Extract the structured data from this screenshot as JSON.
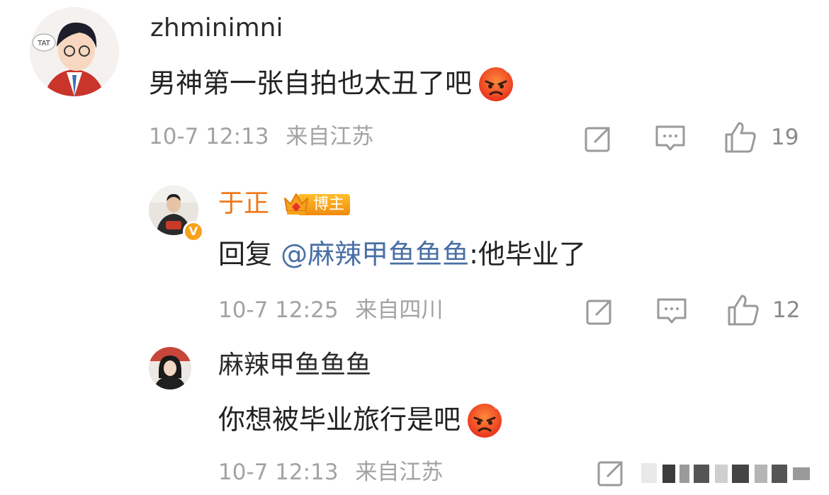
{
  "comments": [
    {
      "username": "zhminimni",
      "text": "男神第一张自拍也太丑了吧",
      "time": "10-7 12:13",
      "location": "来自江苏",
      "likes": "19",
      "avatar_tag": "TAT",
      "emoji": "angry-face-emoji"
    },
    {
      "username": "于正",
      "badge": "博主",
      "verified_mark": "V",
      "reply_prefix": "回复 ",
      "mention": "@麻辣甲鱼鱼鱼",
      "text": ":他毕业了",
      "time": "10-7 12:25",
      "location": "来自四川",
      "likes": "12"
    },
    {
      "username": "麻辣甲鱼鱼鱼",
      "text": "你想被毕业旅行是吧",
      "time": "10-7 12:13",
      "location": "来自江苏",
      "emoji": "angry-face-emoji"
    }
  ],
  "colors": {
    "username": "#2b2b2b",
    "username_highlight": "#f07818",
    "mention": "#4a6fa5",
    "meta": "#a3a3a3",
    "badge": "#f59a12"
  }
}
